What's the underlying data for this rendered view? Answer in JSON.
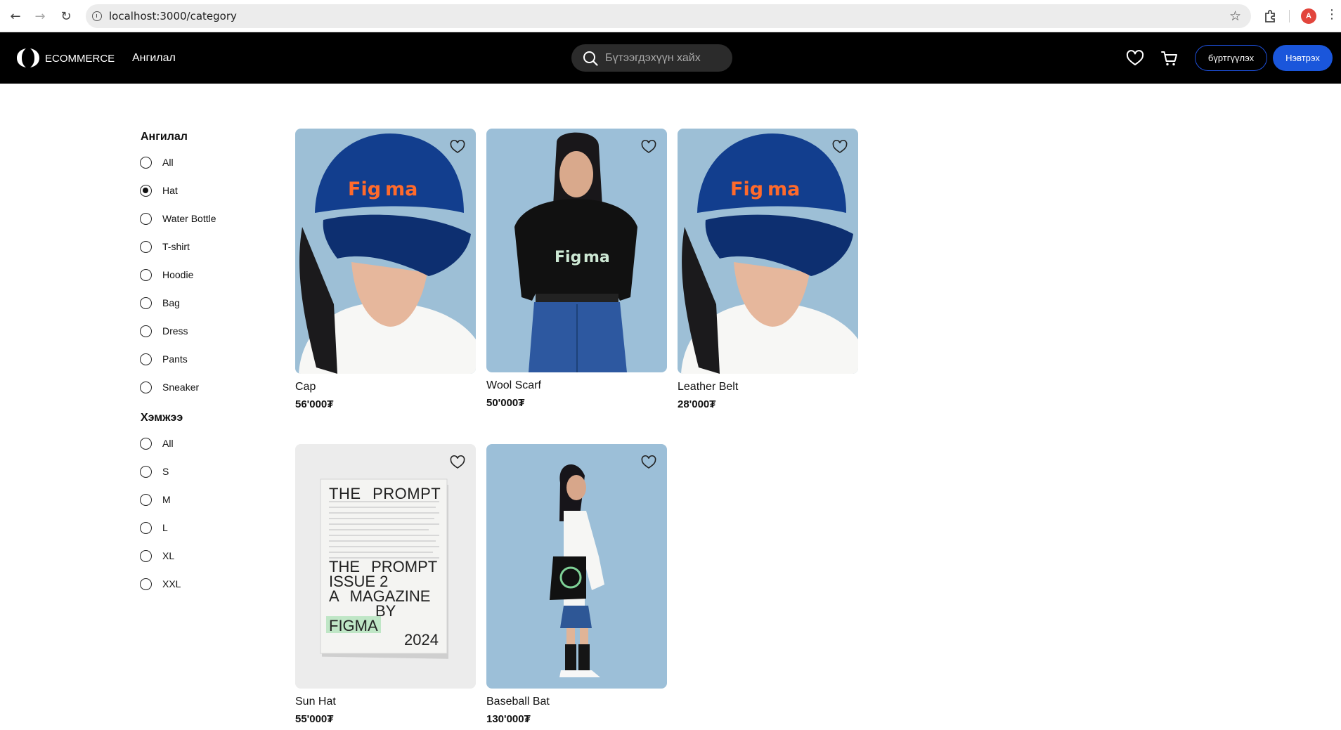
{
  "browser": {
    "url": "localhost:3000/category",
    "profile_initial": "A"
  },
  "header": {
    "brand": "ECOMMERCE",
    "nav_category": "Ангилал",
    "search_placeholder": "Бүтээгдэхүүн хайх",
    "register_label": "бүртгүүлэх",
    "login_label": "Нэвтрэх"
  },
  "sidebar": {
    "category_title": "Ангилал",
    "categories": [
      {
        "label": "All",
        "checked": false
      },
      {
        "label": "Hat",
        "checked": true
      },
      {
        "label": "Water Bottle",
        "checked": false
      },
      {
        "label": "T-shirt",
        "checked": false
      },
      {
        "label": "Hoodie",
        "checked": false
      },
      {
        "label": "Bag",
        "checked": false
      },
      {
        "label": "Dress",
        "checked": false
      },
      {
        "label": "Pants",
        "checked": false
      },
      {
        "label": "Sneaker",
        "checked": false
      }
    ],
    "size_title": "Хэмжээ",
    "sizes": [
      {
        "label": "All",
        "checked": false
      },
      {
        "label": "S",
        "checked": false
      },
      {
        "label": "M",
        "checked": false
      },
      {
        "label": "L",
        "checked": false
      },
      {
        "label": "XL",
        "checked": false
      },
      {
        "label": "XXL",
        "checked": false
      }
    ]
  },
  "products": [
    {
      "name": "Cap",
      "price": "56'000₮",
      "image": "cap-model"
    },
    {
      "name": "Wool Scarf",
      "price": "50'000₮",
      "image": "tshirt-model"
    },
    {
      "name": "Leather Belt",
      "price": "28'000₮",
      "image": "cap-model"
    },
    {
      "name": "Sun Hat",
      "price": "55'000₮",
      "image": "magazine"
    },
    {
      "name": "Baseball Bat",
      "price": "130'000₮",
      "image": "tote-model"
    }
  ],
  "magazine": {
    "title": "THE PROMPT",
    "line1": "THE PROMPT",
    "line2": "ISSUE 2",
    "line3": "A MAGAZINE",
    "line4": "BY",
    "line5": "FIGMA",
    "year": "2024"
  },
  "colors": {
    "header_bg": "#000000",
    "login_bg": "#1a56db",
    "photo_bg": "#9cbfd8",
    "cap_blue": "#0f3a8a",
    "cap_logo": "#ff6a2b"
  }
}
